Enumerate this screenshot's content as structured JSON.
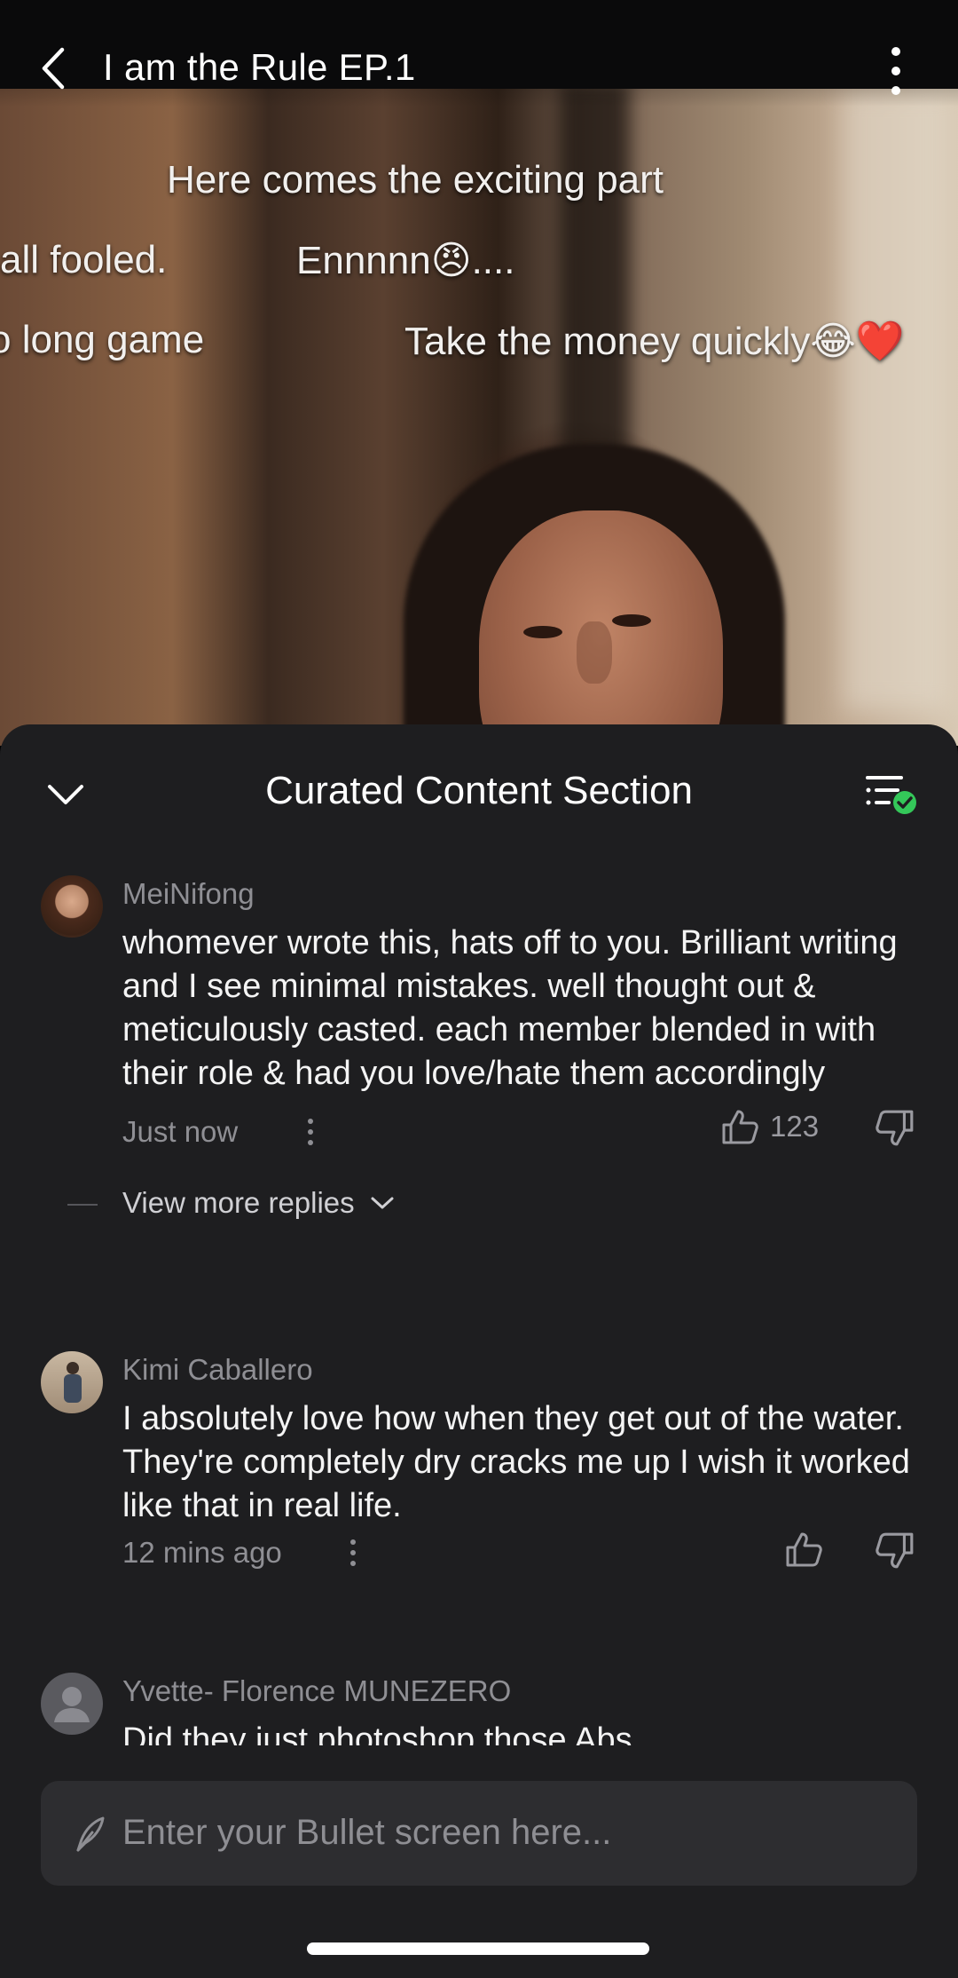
{
  "header": {
    "title": "I am the Rule EP.1"
  },
  "bullets": [
    "Here comes the exciting part",
    "all fooled.",
    "Ennnnn😠....",
    "o long game",
    "Take the money quickly😂❤️"
  ],
  "sheet": {
    "title": "Curated Content Section"
  },
  "comments": [
    {
      "user": "MeiNifong",
      "text": "whomever wrote this, hats off to you. Brilliant writing and I see minimal mistakes. well thought out & meticulously casted. each member blended in with their role & had you love/hate them accordingly",
      "time": "Just now",
      "likes": "123",
      "view_more": "View more replies"
    },
    {
      "user": "Kimi Caballero",
      "text": "I absolutely love how when they get out of the water. They're completely dry cracks me up I wish it worked like that in real life.",
      "time": "12 mins ago",
      "likes": ""
    },
    {
      "user": "Yvette- Florence MUNEZERO",
      "text": "Did they just photoshop those Abs"
    }
  ],
  "input": {
    "placeholder": "Enter your Bullet screen here..."
  },
  "colors": {
    "sheet_bg": "#1e1e20",
    "accent_green": "#34c759",
    "input_bg": "#2d2d30"
  },
  "icons": [
    "back-arrow-icon",
    "more-vertical-icon",
    "chevron-down-icon",
    "filter-check-icon",
    "thumbs-up-icon",
    "thumbs-down-icon",
    "pen-icon"
  ]
}
